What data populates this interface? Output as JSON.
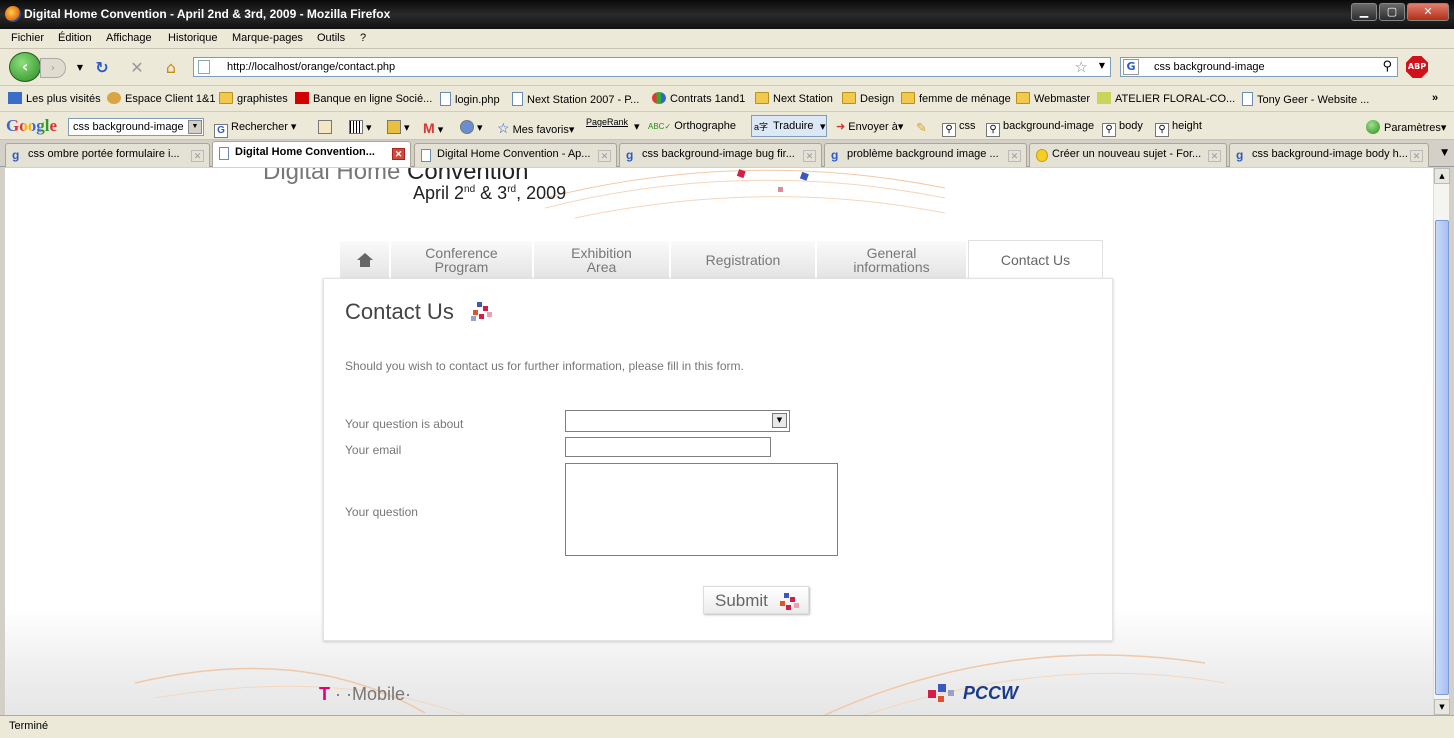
{
  "window": {
    "title": "Digital Home Convention - April 2nd & 3rd, 2009 - Mozilla Firefox"
  },
  "menu": [
    "Fichier",
    "Édition",
    "Affichage",
    "Historique",
    "Marque-pages",
    "Outils",
    "?"
  ],
  "nav": {
    "url": "http://localhost/orange/contact.php",
    "search_value": "css background-image",
    "abp_label": "ABP"
  },
  "bookmarks": [
    "Les plus visités",
    "Espace Client 1&1",
    "graphistes",
    "Banque en ligne Socié...",
    "login.php",
    "Next Station 2007 - P...",
    "Contrats 1and1",
    "Next Station",
    "Design",
    "femme de ménage",
    "Webmaster",
    "ATELIER FLORAL-CO...",
    "Tony Geer - Website ..."
  ],
  "google_toolbar": {
    "logo": "Google",
    "search_value": "css background-image",
    "search_label": "Rechercher",
    "favorites": "Mes favoris",
    "pagerank": "PageRank",
    "spell": "Orthographe",
    "translate": "Traduire",
    "send": "Envoyer à",
    "terms": [
      "css",
      "background-image",
      "body",
      "height"
    ],
    "settings": "Paramètres"
  },
  "tabs": [
    "css ombre portée formulaire i...",
    "Digital Home Convention...",
    "Digital Home Convention - Ap...",
    "css background-image bug fir...",
    "problème background image ...",
    "Créer un nouveau sujet - For...",
    "css background-image body h..."
  ],
  "site": {
    "header_title_a": "Digital Home ",
    "header_title_b": "Convention",
    "header_dates": {
      "part1": "April 2",
      "sup1": "nd",
      "part2": " & 3",
      "sup2": "rd",
      "part3": ", 2009"
    },
    "nav_tabs": [
      {
        "line1": "Conference",
        "line2": "Program"
      },
      {
        "line1": "Exhibition",
        "line2": "Area"
      },
      {
        "line1": "Registration",
        "line2": ""
      },
      {
        "line1": "General",
        "line2": "informations"
      },
      {
        "line1": "Contact Us",
        "line2": ""
      }
    ],
    "panel_title": "Contact Us",
    "intro": "Should you wish to contact us for further information, please fill in this form.",
    "form": {
      "about_label": "Your question is about",
      "email_label": "Your email",
      "question_label": "Your question",
      "submit_label": "Submit"
    },
    "sponsor_left_t": "T",
    "sponsor_left_rest": " · ·Mobile·",
    "sponsor_right": "PCCW"
  },
  "status": "Terminé",
  "colors": {
    "accent_tmobile": "#e20074",
    "pccw_blue": "#1a3a8c",
    "firefox_green": "#2a8a22"
  }
}
